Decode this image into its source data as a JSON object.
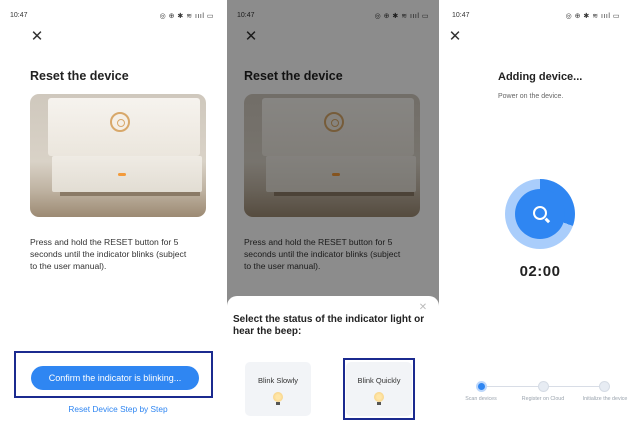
{
  "screen1": {
    "time": "10:47",
    "status_icons": "◎ ⊕ ✱ ≋ ıııl ▭",
    "title": "Reset the device",
    "instructions": "Press and hold the RESET button for 5 seconds until the indicator blinks (subject to the user manual).",
    "confirm_button": "Confirm the indicator is blinking...",
    "link": "Reset Device Step by Step"
  },
  "screen2": {
    "time": "10:47",
    "status_icons": "◎ ⊕ ✱ ≋ ıııl ▭",
    "title": "Reset the device",
    "instructions": "Press and hold the RESET button for 5 seconds until the indicator blinks (subject to the user manual).",
    "sheet_title": "Select the status of the indicator light or hear the beep:",
    "option_slow": "Blink Slowly",
    "option_quick": "Blink Quickly"
  },
  "screen3": {
    "time": "10:47",
    "status_icons": "◎ ⊕ ✱ ≋ ıııl ▭",
    "title": "Adding device...",
    "subtitle": "Power on the device.",
    "timer": "02:00",
    "steps": [
      {
        "label": "Scan devices"
      },
      {
        "label": "Register on Cloud"
      },
      {
        "label": "Initialize the device"
      }
    ]
  },
  "colors": {
    "accent": "#2f86f2",
    "highlight_border": "#1b2a8f"
  },
  "icons": {
    "close": "close-icon",
    "search": "search-icon",
    "bulb": "bulb-icon"
  }
}
